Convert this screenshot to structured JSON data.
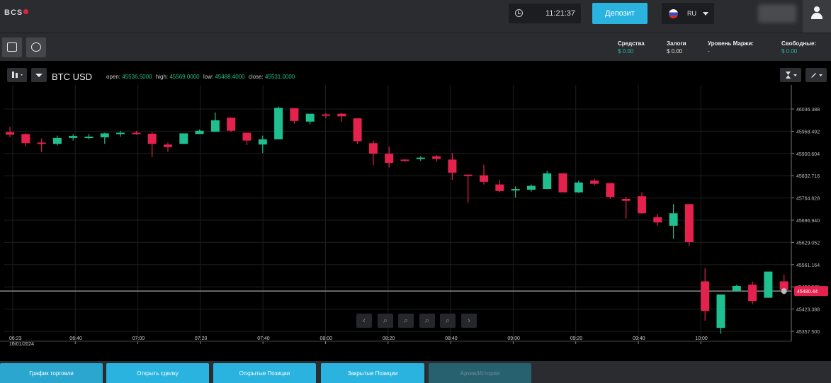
{
  "header": {
    "logo": "BCS",
    "time": "11:21:37",
    "deposit_label": "Депозит",
    "language": "RU"
  },
  "toolbar": {
    "stats": [
      {
        "label": "Средства",
        "value": "$ 0.00"
      },
      {
        "label": "Залоги",
        "value": "$ 0.00"
      },
      {
        "label": "Уровень Маржи:",
        "value": "-"
      },
      {
        "label": "Свободные:",
        "value": "$ 0.00"
      }
    ]
  },
  "chart_header": {
    "symbol": "BTC USD",
    "open_label": "open:",
    "open": "45536.5000",
    "high_label": "high:",
    "high": "45569.0000",
    "low_label": "low:",
    "low": "45488.4000",
    "close_label": "close:",
    "close": "45531.0000"
  },
  "colors": {
    "up": "#1fbf8f",
    "down": "#e5214e",
    "accent": "#2bb3df"
  },
  "chart_data": {
    "type": "candlestick",
    "price_labels": [
      "46036.388",
      "45968.492",
      "45900.604",
      "45832.716",
      "45764.828",
      "45696.940",
      "45629.052",
      "45561.164",
      "45493.276",
      "45423.388",
      "45357.500"
    ],
    "current_price": "45480.44",
    "time_labels": [
      "06:23 10/01/2024",
      "06:40",
      "07:00",
      "07:20",
      "07:40",
      "08:00",
      "08:20",
      "08:40",
      "09:00",
      "09:20",
      "09:40",
      "10:00"
    ],
    "candles": [
      {
        "o": 45966,
        "h": 45982,
        "l": 45950,
        "c": 45958
      },
      {
        "o": 45960,
        "h": 45962,
        "l": 45922,
        "c": 45932
      },
      {
        "o": 45934,
        "h": 45946,
        "l": 45905,
        "c": 45932
      },
      {
        "o": 45930,
        "h": 45955,
        "l": 45925,
        "c": 45948
      },
      {
        "o": 45948,
        "h": 45960,
        "l": 45940,
        "c": 45954
      },
      {
        "o": 45952,
        "h": 45960,
        "l": 45944,
        "c": 45952
      },
      {
        "o": 45950,
        "h": 45964,
        "l": 45930,
        "c": 45962
      },
      {
        "o": 45960,
        "h": 45970,
        "l": 45952,
        "c": 45964
      },
      {
        "o": 45964,
        "h": 45970,
        "l": 45958,
        "c": 45960
      },
      {
        "o": 45961,
        "h": 45966,
        "l": 45890,
        "c": 45930
      },
      {
        "o": 45928,
        "h": 45934,
        "l": 45906,
        "c": 45920
      },
      {
        "o": 45930,
        "h": 45962,
        "l": 45930,
        "c": 45962
      },
      {
        "o": 45960,
        "h": 45974,
        "l": 45960,
        "c": 45970
      },
      {
        "o": 45967,
        "h": 46026,
        "l": 45967,
        "c": 46002
      },
      {
        "o": 46010,
        "h": 46010,
        "l": 45966,
        "c": 45970
      },
      {
        "o": 45964,
        "h": 45964,
        "l": 45926,
        "c": 45940
      },
      {
        "o": 45928,
        "h": 45955,
        "l": 45902,
        "c": 45944
      },
      {
        "o": 45944,
        "h": 46044,
        "l": 45944,
        "c": 46040
      },
      {
        "o": 46039,
        "h": 46039,
        "l": 45992,
        "c": 46000
      },
      {
        "o": 45998,
        "h": 46022,
        "l": 45990,
        "c": 46022
      },
      {
        "o": 46020,
        "h": 46024,
        "l": 46008,
        "c": 46016
      },
      {
        "o": 46022,
        "h": 46024,
        "l": 45998,
        "c": 46014
      },
      {
        "o": 46008,
        "h": 46008,
        "l": 45930,
        "c": 45938
      },
      {
        "o": 45932,
        "h": 45940,
        "l": 45864,
        "c": 45900
      },
      {
        "o": 45900,
        "h": 45922,
        "l": 45858,
        "c": 45872
      },
      {
        "o": 45882,
        "h": 45884,
        "l": 45876,
        "c": 45880
      },
      {
        "o": 45884,
        "h": 45892,
        "l": 45878,
        "c": 45888
      },
      {
        "o": 45892,
        "h": 45896,
        "l": 45876,
        "c": 45884
      },
      {
        "o": 45882,
        "h": 45902,
        "l": 45820,
        "c": 45842
      },
      {
        "o": 45836,
        "h": 45836,
        "l": 45750,
        "c": 45834
      },
      {
        "o": 45834,
        "h": 45866,
        "l": 45806,
        "c": 45814
      },
      {
        "o": 45806,
        "h": 45820,
        "l": 45782,
        "c": 45786
      },
      {
        "o": 45790,
        "h": 45800,
        "l": 45766,
        "c": 45792
      },
      {
        "o": 45790,
        "h": 45806,
        "l": 45784,
        "c": 45802
      },
      {
        "o": 45792,
        "h": 45848,
        "l": 45792,
        "c": 45840
      },
      {
        "o": 45840,
        "h": 45840,
        "l": 45784,
        "c": 45782
      },
      {
        "o": 45782,
        "h": 45818,
        "l": 45780,
        "c": 45812
      },
      {
        "o": 45818,
        "h": 45824,
        "l": 45804,
        "c": 45808
      },
      {
        "o": 45810,
        "h": 45810,
        "l": 45762,
        "c": 45768
      },
      {
        "o": 45762,
        "h": 45768,
        "l": 45702,
        "c": 45756
      },
      {
        "o": 45770,
        "h": 45782,
        "l": 45716,
        "c": 45718
      },
      {
        "o": 45706,
        "h": 45716,
        "l": 45680,
        "c": 45690
      },
      {
        "o": 45680,
        "h": 45746,
        "l": 45640,
        "c": 45718
      },
      {
        "o": 45746,
        "h": 45746,
        "l": 45618,
        "c": 45630
      },
      {
        "o": 45510,
        "h": 45550,
        "l": 45390,
        "c": 45420
      },
      {
        "o": 45368,
        "h": 45470,
        "l": 45350,
        "c": 45470
      },
      {
        "o": 45480,
        "h": 45500,
        "l": 45480,
        "c": 45496
      },
      {
        "o": 45500,
        "h": 45510,
        "l": 45440,
        "c": 45450
      },
      {
        "o": 45460,
        "h": 45540,
        "l": 45460,
        "c": 45540
      },
      {
        "o": 45510,
        "h": 45530,
        "l": 45470,
        "c": 45484
      }
    ]
  },
  "bottom_tabs": [
    {
      "label": "График торговли"
    },
    {
      "label": "Открыть сделку"
    },
    {
      "label": "Открытые Позиции"
    },
    {
      "label": "Закрытые Позиции"
    },
    {
      "label": "Архив/История"
    }
  ]
}
